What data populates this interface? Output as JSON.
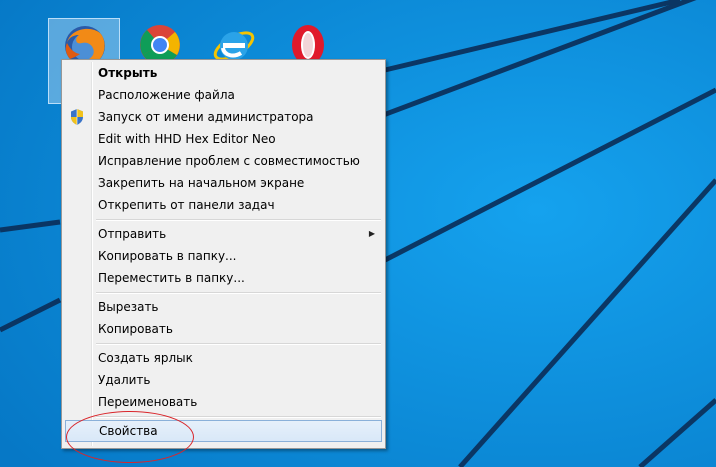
{
  "desktop": {
    "icons": [
      {
        "name": "firefox",
        "selected": true
      },
      {
        "name": "chrome",
        "selected": false
      },
      {
        "name": "internet-explorer",
        "selected": false
      },
      {
        "name": "opera",
        "selected": false
      }
    ],
    "wallpaper_color": "#0a84d4"
  },
  "context_menu": {
    "items": [
      {
        "label": "Открыть",
        "bold": true
      },
      {
        "label": "Расположение файла"
      },
      {
        "label": "Запуск от имени администратора",
        "icon": "uac-shield-icon"
      },
      {
        "label": "Edit with HHD Hex Editor Neo"
      },
      {
        "label": "Исправление проблем с совместимостью"
      },
      {
        "label": "Закрепить на начальном экране"
      },
      {
        "label": "Открепить от панели задач"
      },
      {
        "label": "Отправить",
        "submenu": true
      },
      {
        "label": "Копировать в папку..."
      },
      {
        "label": "Переместить в папку..."
      },
      {
        "label": "Вырезать"
      },
      {
        "label": "Копировать"
      },
      {
        "label": "Создать ярлык"
      },
      {
        "label": "Удалить"
      },
      {
        "label": "Переименовать"
      },
      {
        "label": "Свойства",
        "highlighted": true
      }
    ],
    "submenu_arrow": "▶"
  },
  "annotation": {
    "color": "#d9262b",
    "target": "Свойства"
  }
}
